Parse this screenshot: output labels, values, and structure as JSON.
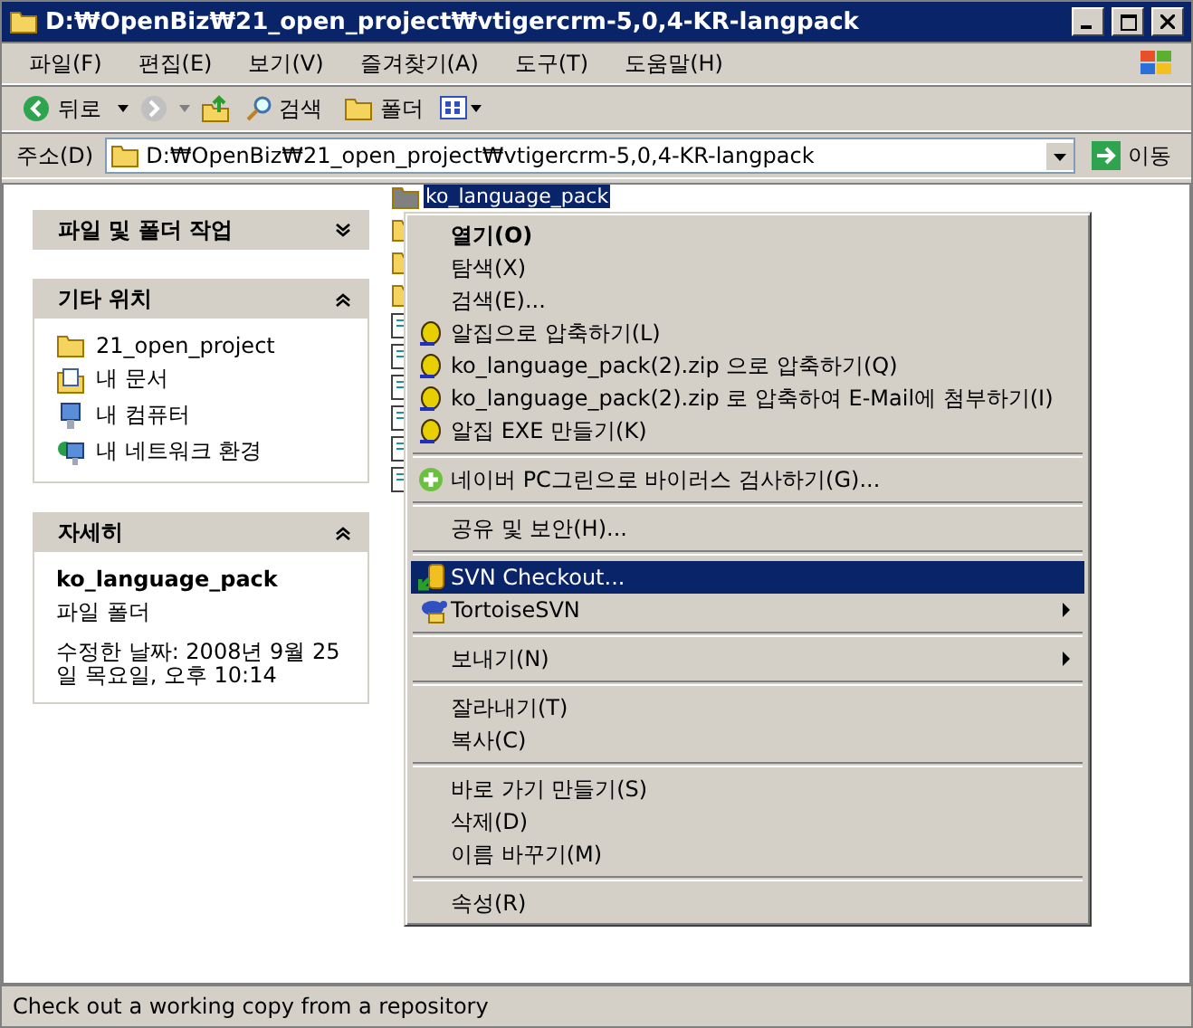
{
  "window": {
    "title": "D:₩OpenBiz₩21_open_project₩vtigercrm-5,0,4-KR-langpack"
  },
  "menubar": [
    "파일(F)",
    "편집(E)",
    "보기(V)",
    "즐겨찾기(A)",
    "도구(T)",
    "도움말(H)"
  ],
  "toolbar": {
    "back": "뒤로",
    "search": "검색",
    "folders": "폴더"
  },
  "address": {
    "label": "주소(D)",
    "value": "D:₩OpenBiz₩21_open_project₩vtigercrm-5,0,4-KR-langpack",
    "go": "이동"
  },
  "task_panels": [
    {
      "title": "파일 및 폴더 작업",
      "expanded": false
    },
    {
      "title": "기타 위치",
      "expanded": true,
      "kind": "links",
      "items": [
        {
          "label": "21_open_project",
          "kind": "folder"
        },
        {
          "label": "내 문서",
          "kind": "documents"
        },
        {
          "label": "내 컴퓨터",
          "kind": "computer"
        },
        {
          "label": "내 네트워크 환경",
          "kind": "network"
        }
      ]
    },
    {
      "title": "자세히",
      "expanded": true,
      "kind": "details",
      "name": "ko_language_pack",
      "type": "파일 폴더",
      "modified": "수정한 날짜: 2008년 9월 25일 목요일, 오후 10:14"
    }
  ],
  "files": [
    {
      "label": "ko_language_pack",
      "selected": true
    }
  ],
  "context_menu": [
    {
      "kind": "plain",
      "label": "열기(O)",
      "default": true,
      "selected": false
    },
    {
      "kind": "plain",
      "label": "탐색(X)",
      "default": false,
      "selected": false
    },
    {
      "kind": "plain",
      "label": "검색(E)...",
      "default": false,
      "selected": false
    },
    {
      "kind": "alzip",
      "label": "알집으로 압축하기(L)",
      "default": false,
      "selected": false
    },
    {
      "kind": "alzip",
      "label": "ko_language_pack(2).zip 으로 압축하기(Q)",
      "default": false,
      "selected": false
    },
    {
      "kind": "alzip",
      "label": "ko_language_pack(2).zip 로 압축하여 E-Mail에 첨부하기(I)",
      "default": false,
      "selected": false
    },
    {
      "kind": "alzip",
      "label": "알집 EXE 만들기(K)",
      "default": false,
      "selected": false
    },
    {
      "kind": "separator"
    },
    {
      "kind": "naver",
      "label": "네이버 PC그린으로 바이러스 검사하기(G)...",
      "default": false,
      "selected": false
    },
    {
      "kind": "separator"
    },
    {
      "kind": "plain",
      "label": "공유 및 보안(H)...",
      "default": false,
      "selected": false
    },
    {
      "kind": "separator"
    },
    {
      "kind": "svn",
      "label": "SVN Checkout...",
      "default": false,
      "selected": true
    },
    {
      "kind": "tortoise",
      "label": "TortoiseSVN",
      "default": false,
      "selected": false,
      "submenu": true
    },
    {
      "kind": "separator"
    },
    {
      "kind": "plain",
      "label": "보내기(N)",
      "default": false,
      "selected": false,
      "submenu": true
    },
    {
      "kind": "separator"
    },
    {
      "kind": "plain",
      "label": "잘라내기(T)",
      "default": false,
      "selected": false
    },
    {
      "kind": "plain",
      "label": "복사(C)",
      "default": false,
      "selected": false
    },
    {
      "kind": "separator"
    },
    {
      "kind": "plain",
      "label": "바로 가기 만들기(S)",
      "default": false,
      "selected": false
    },
    {
      "kind": "plain",
      "label": "삭제(D)",
      "default": false,
      "selected": false
    },
    {
      "kind": "plain",
      "label": "이름 바꾸기(M)",
      "default": false,
      "selected": false
    },
    {
      "kind": "separator"
    },
    {
      "kind": "plain",
      "label": "속성(R)",
      "default": false,
      "selected": false
    }
  ],
  "status_bar": "Check out a working copy from a repository"
}
